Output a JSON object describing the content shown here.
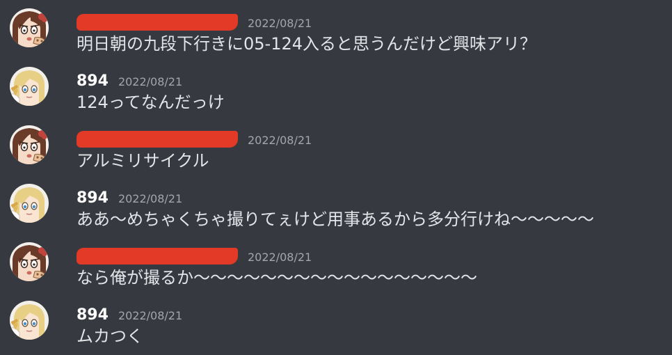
{
  "messages": [
    {
      "author": "",
      "author_redacted": true,
      "avatar": "brown-hair-girl-avatar",
      "timestamp": "2022/08/21",
      "text": "明日朝の九段下行きに05-124入ると思うんだけど興味アリ？"
    },
    {
      "author": "894",
      "author_redacted": false,
      "avatar": "blonde-girl-avatar",
      "timestamp": "2022/08/21",
      "text": "124ってなんだっけ"
    },
    {
      "author": "",
      "author_redacted": true,
      "avatar": "brown-hair-girl-avatar",
      "timestamp": "2022/08/21",
      "text": "アルミリサイクル"
    },
    {
      "author": "894",
      "author_redacted": false,
      "avatar": "blonde-girl-avatar",
      "timestamp": "2022/08/21",
      "text": "ああ〜めちゃくちゃ撮りてぇけど用事あるから多分行けね〜〜〜〜〜"
    },
    {
      "author": "",
      "author_redacted": true,
      "avatar": "brown-hair-girl-avatar",
      "timestamp": "2022/08/21",
      "text": "なら俺が撮るか〜〜〜〜〜〜〜〜〜〜〜〜〜〜〜〜〜"
    },
    {
      "author": "894",
      "author_redacted": false,
      "avatar": "blonde-girl-avatar",
      "timestamp": "2022/08/21",
      "text": "ムカつく"
    }
  ],
  "colors": {
    "background": "#36393f",
    "username": "#ffffff",
    "timestamp": "#a3a6aa",
    "message_text": "#e3e5e8",
    "redaction": "#e23a26"
  }
}
